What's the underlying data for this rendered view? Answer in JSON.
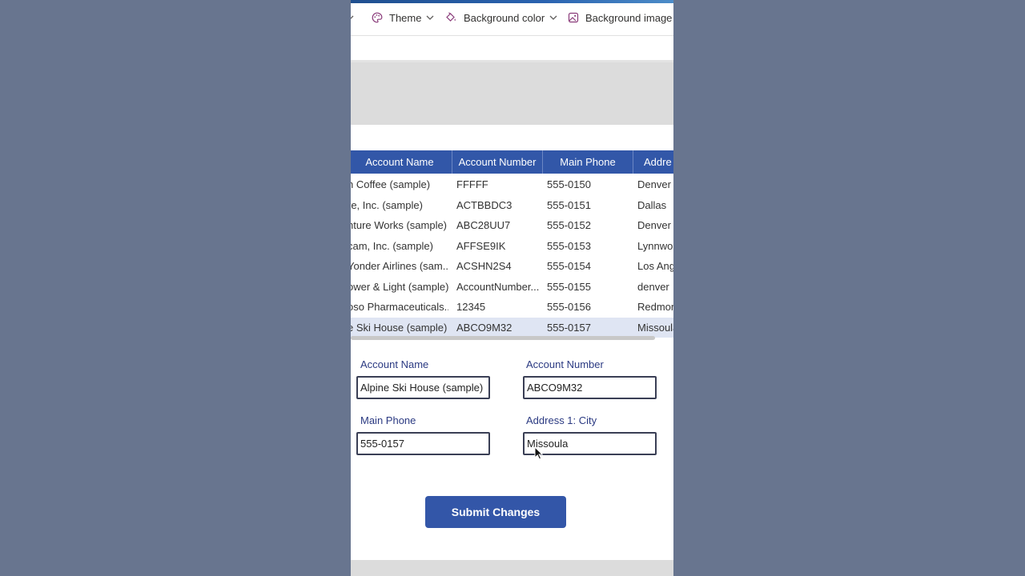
{
  "ribbon": {
    "theme_label": "Theme",
    "background_color_label": "Background color",
    "background_image_label": "Background image"
  },
  "table": {
    "columns": [
      "Account Name",
      "Account Number",
      "Main Phone",
      "Addre"
    ],
    "rows": [
      {
        "name": "n Coffee (sample)",
        "number": "FFFFF",
        "phone": "555-0150",
        "city": "Denver"
      },
      {
        "name": "re, Inc. (sample)",
        "number": "ACTBBDC3",
        "phone": "555-0151",
        "city": "Dallas"
      },
      {
        "name": "nture Works (sample)",
        "number": "ABC28UU7",
        "phone": "555-0152",
        "city": "Denver"
      },
      {
        "name": "cam, Inc. (sample)",
        "number": "AFFSE9IK",
        "phone": "555-0153",
        "city": "Lynnwo"
      },
      {
        "name": "Yonder Airlines (sam...",
        "number": "ACSHN2S4",
        "phone": "555-0154",
        "city": "Los Ang"
      },
      {
        "name": "ower & Light (sample)",
        "number": "AccountNumber...",
        "phone": "555-0155",
        "city": "denver"
      },
      {
        "name": "oso Pharmaceuticals...",
        "number": "12345",
        "phone": "555-0156",
        "city": "Redmon"
      },
      {
        "name": "e Ski House (sample)",
        "number": "ABCO9M32",
        "phone": "555-0157",
        "city": "Missoula"
      }
    ],
    "selected_index": 7
  },
  "form": {
    "account_name_label": "Account Name",
    "account_name_value": "Alpine Ski House (sample)",
    "account_number_label": "Account Number",
    "account_number_value": "ABCO9M32",
    "main_phone_label": "Main Phone",
    "main_phone_value": "555-0157",
    "city_label": "Address 1: City",
    "city_value": "Missoula"
  },
  "submit_label": "Submit Changes",
  "colors": {
    "accent": "#3257a8",
    "page_background": "#68758f",
    "selected_row": "#dfe5f3",
    "label_text": "#2b3a82"
  },
  "icons": [
    "theme-icon",
    "paint-bucket-icon",
    "image-icon",
    "chevron-down-icon",
    "mouse-cursor-icon"
  ]
}
